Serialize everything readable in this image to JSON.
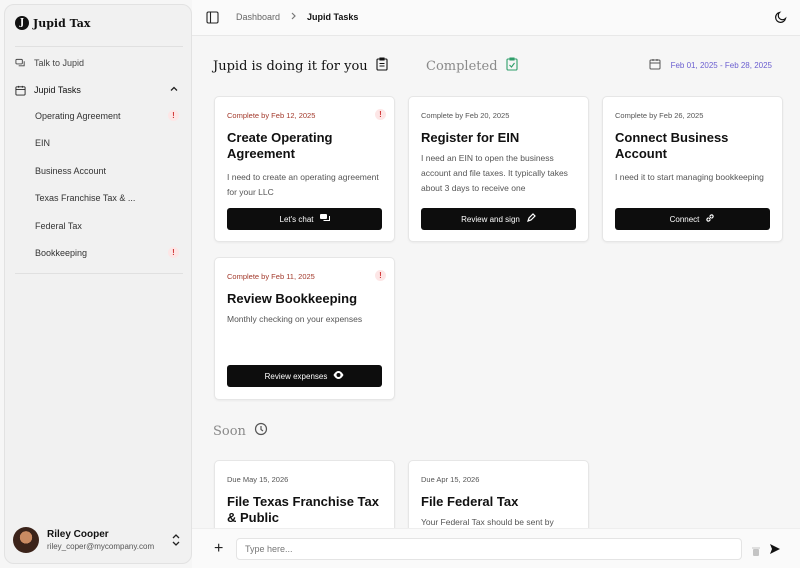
{
  "app": {
    "name": "Jupid Tax",
    "logo_letter": "J"
  },
  "sidebar": {
    "talk": "Talk to Jupid",
    "tasks_label": "Jupid Tasks",
    "items": [
      {
        "label": "Operating Agreement",
        "alert": "!"
      },
      {
        "label": "EIN"
      },
      {
        "label": "Business Account"
      },
      {
        "label": "Texas Franchise Tax & ..."
      },
      {
        "label": "Federal Tax"
      },
      {
        "label": "Bookkeeping",
        "alert": "!"
      }
    ]
  },
  "user": {
    "name": "Riley Cooper",
    "email": "riley_coper@mycompany.com"
  },
  "breadcrumb": {
    "root": "Dashboard",
    "current": "Jupid Tasks"
  },
  "sections": {
    "doing": "Jupid is doing it for you",
    "completed": "Completed",
    "soon": "Soon"
  },
  "date_range": "Feb 01, 2025 - Feb 28, 2025",
  "cards": [
    {
      "due": "Complete by Feb 12, 2025",
      "alert": "!",
      "title": "Create Operating Agreement",
      "desc": "I need to create an operating agreement for your LLC",
      "button": "Let's chat"
    },
    {
      "due": "Complete by Feb 20, 2025",
      "title": "Register for EIN",
      "desc": "I need an EIN to open the business account and file taxes. It typically takes about 3 days to receive one",
      "button": "Review and sign"
    },
    {
      "due": "Complete by Feb 26, 2025",
      "title": "Connect Business Account",
      "desc": "I need it to start managing bookkeeping",
      "button": "Connect"
    },
    {
      "due": "Complete by Feb 11, 2025",
      "alert": "!",
      "title": "Review Bookkeeping",
      "desc": "Monthly checking on your expenses",
      "button": "Review expenses"
    }
  ],
  "soon_cards": [
    {
      "due": "Due May 15, 2026",
      "title": "File Texas Franchise Tax & Public",
      "desc": ""
    },
    {
      "due": "Due Apr 15, 2026",
      "title": "File Federal Tax",
      "desc": "Your Federal Tax should be sent by"
    }
  ],
  "composer": {
    "placeholder": "Type here..."
  },
  "colors": {
    "accent": "#6b5fd0",
    "alert": "#d23a3a",
    "completed_icon": "#2f9e6a"
  }
}
